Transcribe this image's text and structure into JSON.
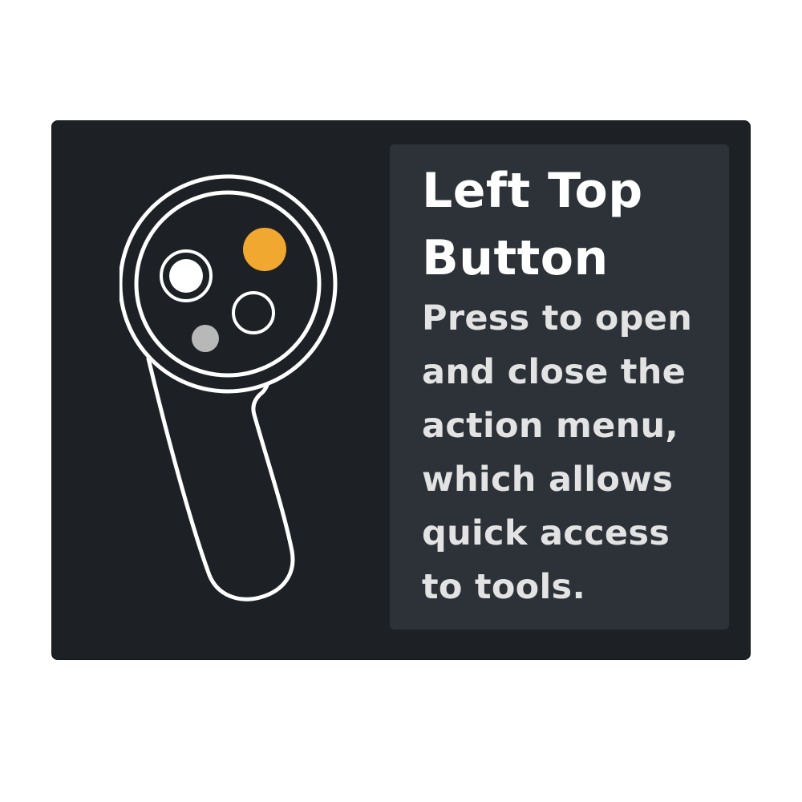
{
  "tooltip": {
    "title": "Left Top Button",
    "description": "Press to open and close the action menu, which allows quick access to tools."
  },
  "controller": {
    "icon": "vr-controller-icon",
    "highlighted_button": "top-button",
    "colors": {
      "outline": "#ffffff",
      "highlight": "#f0a830",
      "secondary": "#b8b8b8",
      "card_background": "#1d2126",
      "panel_background": "#2d3238"
    }
  }
}
